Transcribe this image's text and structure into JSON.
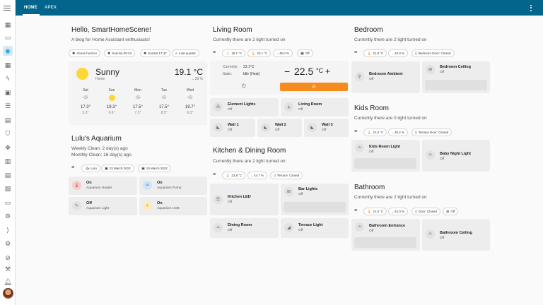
{
  "tabs": [
    {
      "label": "HOME"
    },
    {
      "label": "APEX"
    }
  ],
  "header": {
    "title": "Hello, SmartHomeScene!",
    "subtitle": "A blog for Home Assistant enthusiasts!"
  },
  "sun_chips": [
    "Above horizon",
    "Sunrise 05:23",
    "Sunset 17:47",
    "Last quarter"
  ],
  "weather": {
    "condition": "Sunny",
    "location": "Home",
    "temp": "19.1 °C",
    "humidity": "28 %",
    "forecast": [
      {
        "day": "Sat",
        "hi": "17.3°",
        "lo": "5.3°"
      },
      {
        "day": "Sun",
        "hi": "19.3°",
        "lo": "6.8°"
      },
      {
        "day": "Mon",
        "hi": "17.5°",
        "lo": "7.3°"
      },
      {
        "day": "Tue",
        "hi": "17.5°",
        "lo": "8.5°"
      },
      {
        "day": "Wed",
        "hi": "19.7°",
        "lo": "6.3°"
      }
    ]
  },
  "aquarium": {
    "title": "Lulu's Aquarium",
    "weekly": "Weekly Clean:  2 day(s) ago",
    "monthly": "Monthly Clean: 16 day(s) ago",
    "chips": [
      "Lulu",
      "23 March 2022",
      "10 March 2022"
    ],
    "tiles": [
      {
        "state": "On",
        "name": "Aquarium Heater"
      },
      {
        "state": "On",
        "name": "Aquarium Pump"
      },
      {
        "state": "Off",
        "name": "Aquarium Light"
      },
      {
        "state": "On",
        "name": "Aquarium UVB"
      }
    ]
  },
  "living": {
    "title": "Living Room",
    "status": "Currently there are 2 light turned on",
    "chips": [
      "19.1 °C",
      "23.1 °C",
      "45.0 %",
      "Off"
    ],
    "thermostat": {
      "current_label": "Currently:",
      "current": "23.1°C",
      "state_label": "State:",
      "state": "Idle (Heat)",
      "minus": "−",
      "setpoint": "22.5",
      "unit": "°C",
      "plus": "+"
    },
    "tiles": [
      {
        "name": "Element Lights",
        "state": "Off"
      },
      {
        "name": "Living Room",
        "state": "Off"
      },
      {
        "name": "Wall 1",
        "state": "Off"
      },
      {
        "name": "Wall 2",
        "state": "Off"
      },
      {
        "name": "Wall 3",
        "state": "Off"
      }
    ]
  },
  "kitchen": {
    "title": "Kitchen & Dining Room",
    "status": "Currently there are 2 light turned on",
    "chips": [
      "23.8 °C",
      "44.7 %",
      "Terrace: Closed"
    ],
    "tiles": [
      {
        "name": "Kitchen LED",
        "state": "Off"
      },
      {
        "name": "Bar Lights",
        "state": "Off"
      },
      {
        "name": "Dining Room",
        "state": "Off"
      },
      {
        "name": "Terrace Light",
        "state": "Off"
      }
    ]
  },
  "bedroom": {
    "title": "Bedroom",
    "status": "Currently there are 2 light turned on",
    "chips": [
      "21.9 °C",
      "43.0 %",
      "Bedroom Door: Closed"
    ],
    "tiles": [
      {
        "name": "Bedroom Ambient",
        "state": "Off"
      },
      {
        "name": "Bedroom Ceiling",
        "state": "Off"
      }
    ]
  },
  "kids": {
    "title": "Kids Room",
    "status": "Currently there are 0 light turned on",
    "chips": [
      "21.6 °C",
      "45.2 %",
      "Terrace Door: Closed"
    ],
    "tiles": [
      {
        "name": "Kids Room Light",
        "state": "Off"
      },
      {
        "name": "Baby Night Light",
        "state": "Off"
      }
    ]
  },
  "bathroom": {
    "title": "Bathroom",
    "status": "Currently there are 2 light turned on",
    "chips": [
      "21.6 °C",
      "44.0 %",
      "Door: Closed",
      "Off"
    ],
    "tiles": [
      {
        "name": "Bathroom Entrance",
        "state": "Off"
      },
      {
        "name": "Bathroom Ceiling",
        "state": "Off"
      }
    ]
  },
  "colors": {
    "header": "#03658c",
    "accent": "#f58c1d",
    "sun": "#fdd835"
  }
}
